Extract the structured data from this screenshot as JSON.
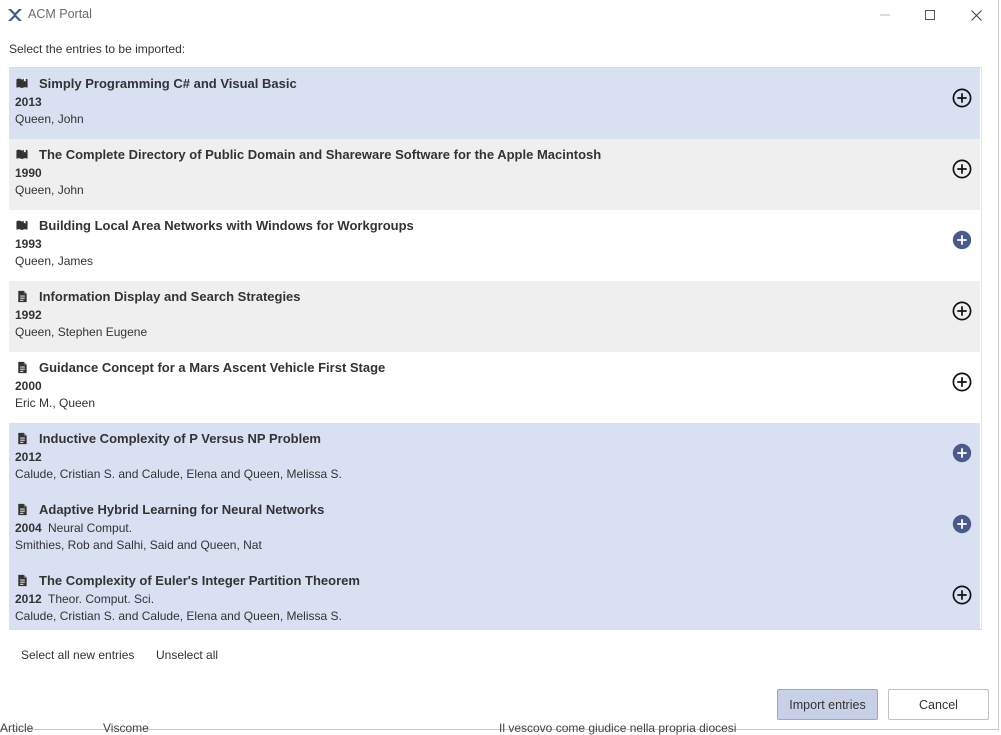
{
  "window": {
    "title": "ACM Portal"
  },
  "instruction": "Select the entries to be imported:",
  "entries": [
    {
      "type_icon": "book-icon",
      "title": "Simply Programming C# and Visual Basic",
      "year": "2013",
      "journal": "",
      "authors": "Queen, John",
      "state": "selected",
      "add_icon": "plus-circle-outline-icon"
    },
    {
      "type_icon": "book-icon",
      "title": "The Complete Directory of Public Domain and Shareware Software for the Apple Macintosh",
      "year": "1990",
      "journal": "",
      "authors": "Queen, John",
      "state": "alternate",
      "add_icon": "plus-circle-outline-icon"
    },
    {
      "type_icon": "book-icon",
      "title": "Building Local Area Networks with Windows for Workgroups",
      "year": "1993",
      "journal": "",
      "authors": "Queen, James",
      "state": "plain",
      "add_icon": "plus-circle-filled-icon"
    },
    {
      "type_icon": "article-icon",
      "title": "Information Display and Search Strategies",
      "year": "1992",
      "journal": "",
      "authors": "Queen, Stephen Eugene",
      "state": "alternate",
      "add_icon": "plus-circle-outline-icon"
    },
    {
      "type_icon": "article-icon",
      "title": "Guidance Concept for a Mars Ascent Vehicle First Stage",
      "year": "2000",
      "journal": "",
      "authors": "Eric M., Queen",
      "state": "plain",
      "add_icon": "plus-circle-outline-icon"
    },
    {
      "type_icon": "article-icon",
      "title": "Inductive Complexity of P Versus NP Problem",
      "year": "2012",
      "journal": "",
      "authors": "Calude, Cristian S. and Calude, Elena and Queen, Melissa S.",
      "state": "selected",
      "add_icon": "plus-circle-filled-icon"
    },
    {
      "type_icon": "article-icon",
      "title": "Adaptive Hybrid Learning for Neural Networks",
      "year": "2004",
      "journal": "Neural Comput.",
      "authors": "Smithies, Rob and Salhi, Said and Queen, Nat",
      "state": "selected",
      "add_icon": "plus-circle-filled-icon"
    },
    {
      "type_icon": "article-icon",
      "title": "The Complexity of Euler's Integer Partition Theorem",
      "year": "2012",
      "journal": "Theor. Comput. Sci.",
      "authors": "Calude, Cristian S. and Calude, Elena and Queen, Melissa S.",
      "state": "selected",
      "add_icon": "plus-circle-outline-icon"
    }
  ],
  "actions": {
    "select_all": "Select all new entries",
    "unselect_all": "Unselect all"
  },
  "buttons": {
    "import": "Import entries",
    "cancel": "Cancel"
  },
  "background_window": {
    "col1": "Article",
    "col2": "Viscome",
    "col3": "Il vescovo come giudice nella propria diocesi"
  },
  "colors": {
    "selected_row": "#d8e0f2",
    "alternate_row": "#efefef",
    "accent_filled": "#4a5a8a",
    "import_button": "#c7d0e6"
  }
}
